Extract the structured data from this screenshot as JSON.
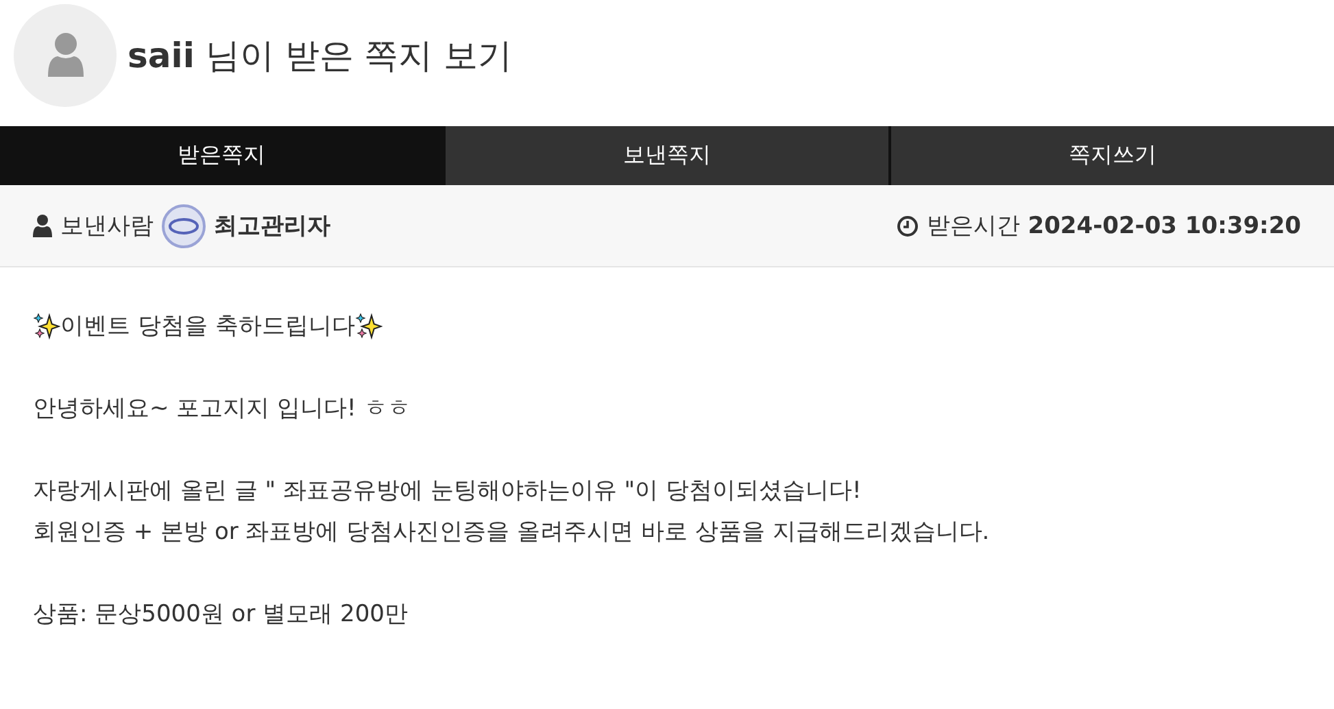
{
  "header": {
    "username": "saii",
    "title": "님이 받은 쪽지 보기"
  },
  "tabs": [
    {
      "label": "받은쪽지",
      "selected": true
    },
    {
      "label": "보낸쪽지",
      "selected": false
    },
    {
      "label": "쪽지쓰기",
      "selected": false
    }
  ],
  "meta": {
    "sender_label": "보낸사람",
    "sender": "최고관리자",
    "time_label": "받은시간",
    "time": "2024-02-03 10:39:20"
  },
  "message": {
    "heading": "이벤트 당첨을 축하드립니다",
    "paragraphs": [
      [
        "안녕하세요~ 포고지지 입니다! ㅎㅎ"
      ],
      [
        "자랑게시판에 올린 글 \" 좌표공유방에 눈팅해야하는이유 \"이 당첨이되셨습니다!",
        "회원인증 + 본방 or 좌표방에 당첨사진인증을 올려주시면 바로 상품을 지급해드리겠습니다."
      ],
      [
        "상품: 문상5000원 or 별모래 200만"
      ]
    ]
  }
}
